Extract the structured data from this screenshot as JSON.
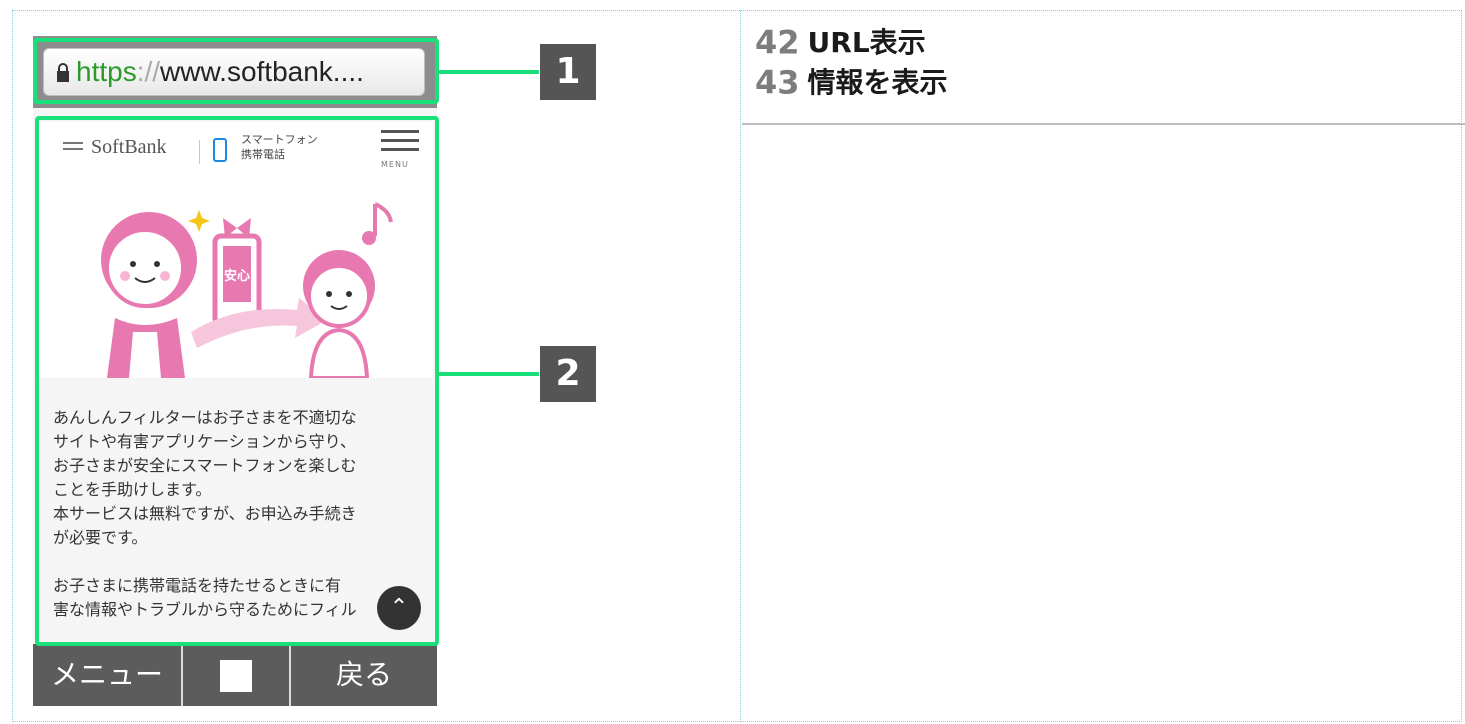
{
  "legend": {
    "items": [
      {
        "num": "42",
        "label": "URL表示"
      },
      {
        "num": "43",
        "label": "情報を表示"
      }
    ]
  },
  "phone": {
    "url": {
      "https": "https",
      "sep": "://",
      "host": "www.softbank...."
    },
    "header": {
      "logo": "SoftBank",
      "category_line1": "スマートフォン",
      "category_line2": "携帯電話",
      "menu_label": "MENU"
    },
    "hero": {
      "badge": "安心"
    },
    "body": {
      "p1": "あんしんフィルターはお子さまを不適切な\nサイトや有害アプリケーションから守り、\nお子さまが安全にスマートフォンを楽しむ\nことを手助けします。\n本サービスは無料ですが、お申込み手続き\nが必要です。",
      "p2": "お子さまに携帯電話を持たせるときに有\n害な情報やトラブルから守るためにフィル"
    },
    "bottom_bar": {
      "menu": "メニュー",
      "back": "戻る"
    }
  },
  "callouts": {
    "one": "1",
    "two": "2"
  },
  "colors": {
    "highlight": "#19e07a",
    "url_https": "#2b9a2b",
    "pink": "#e879b0"
  }
}
